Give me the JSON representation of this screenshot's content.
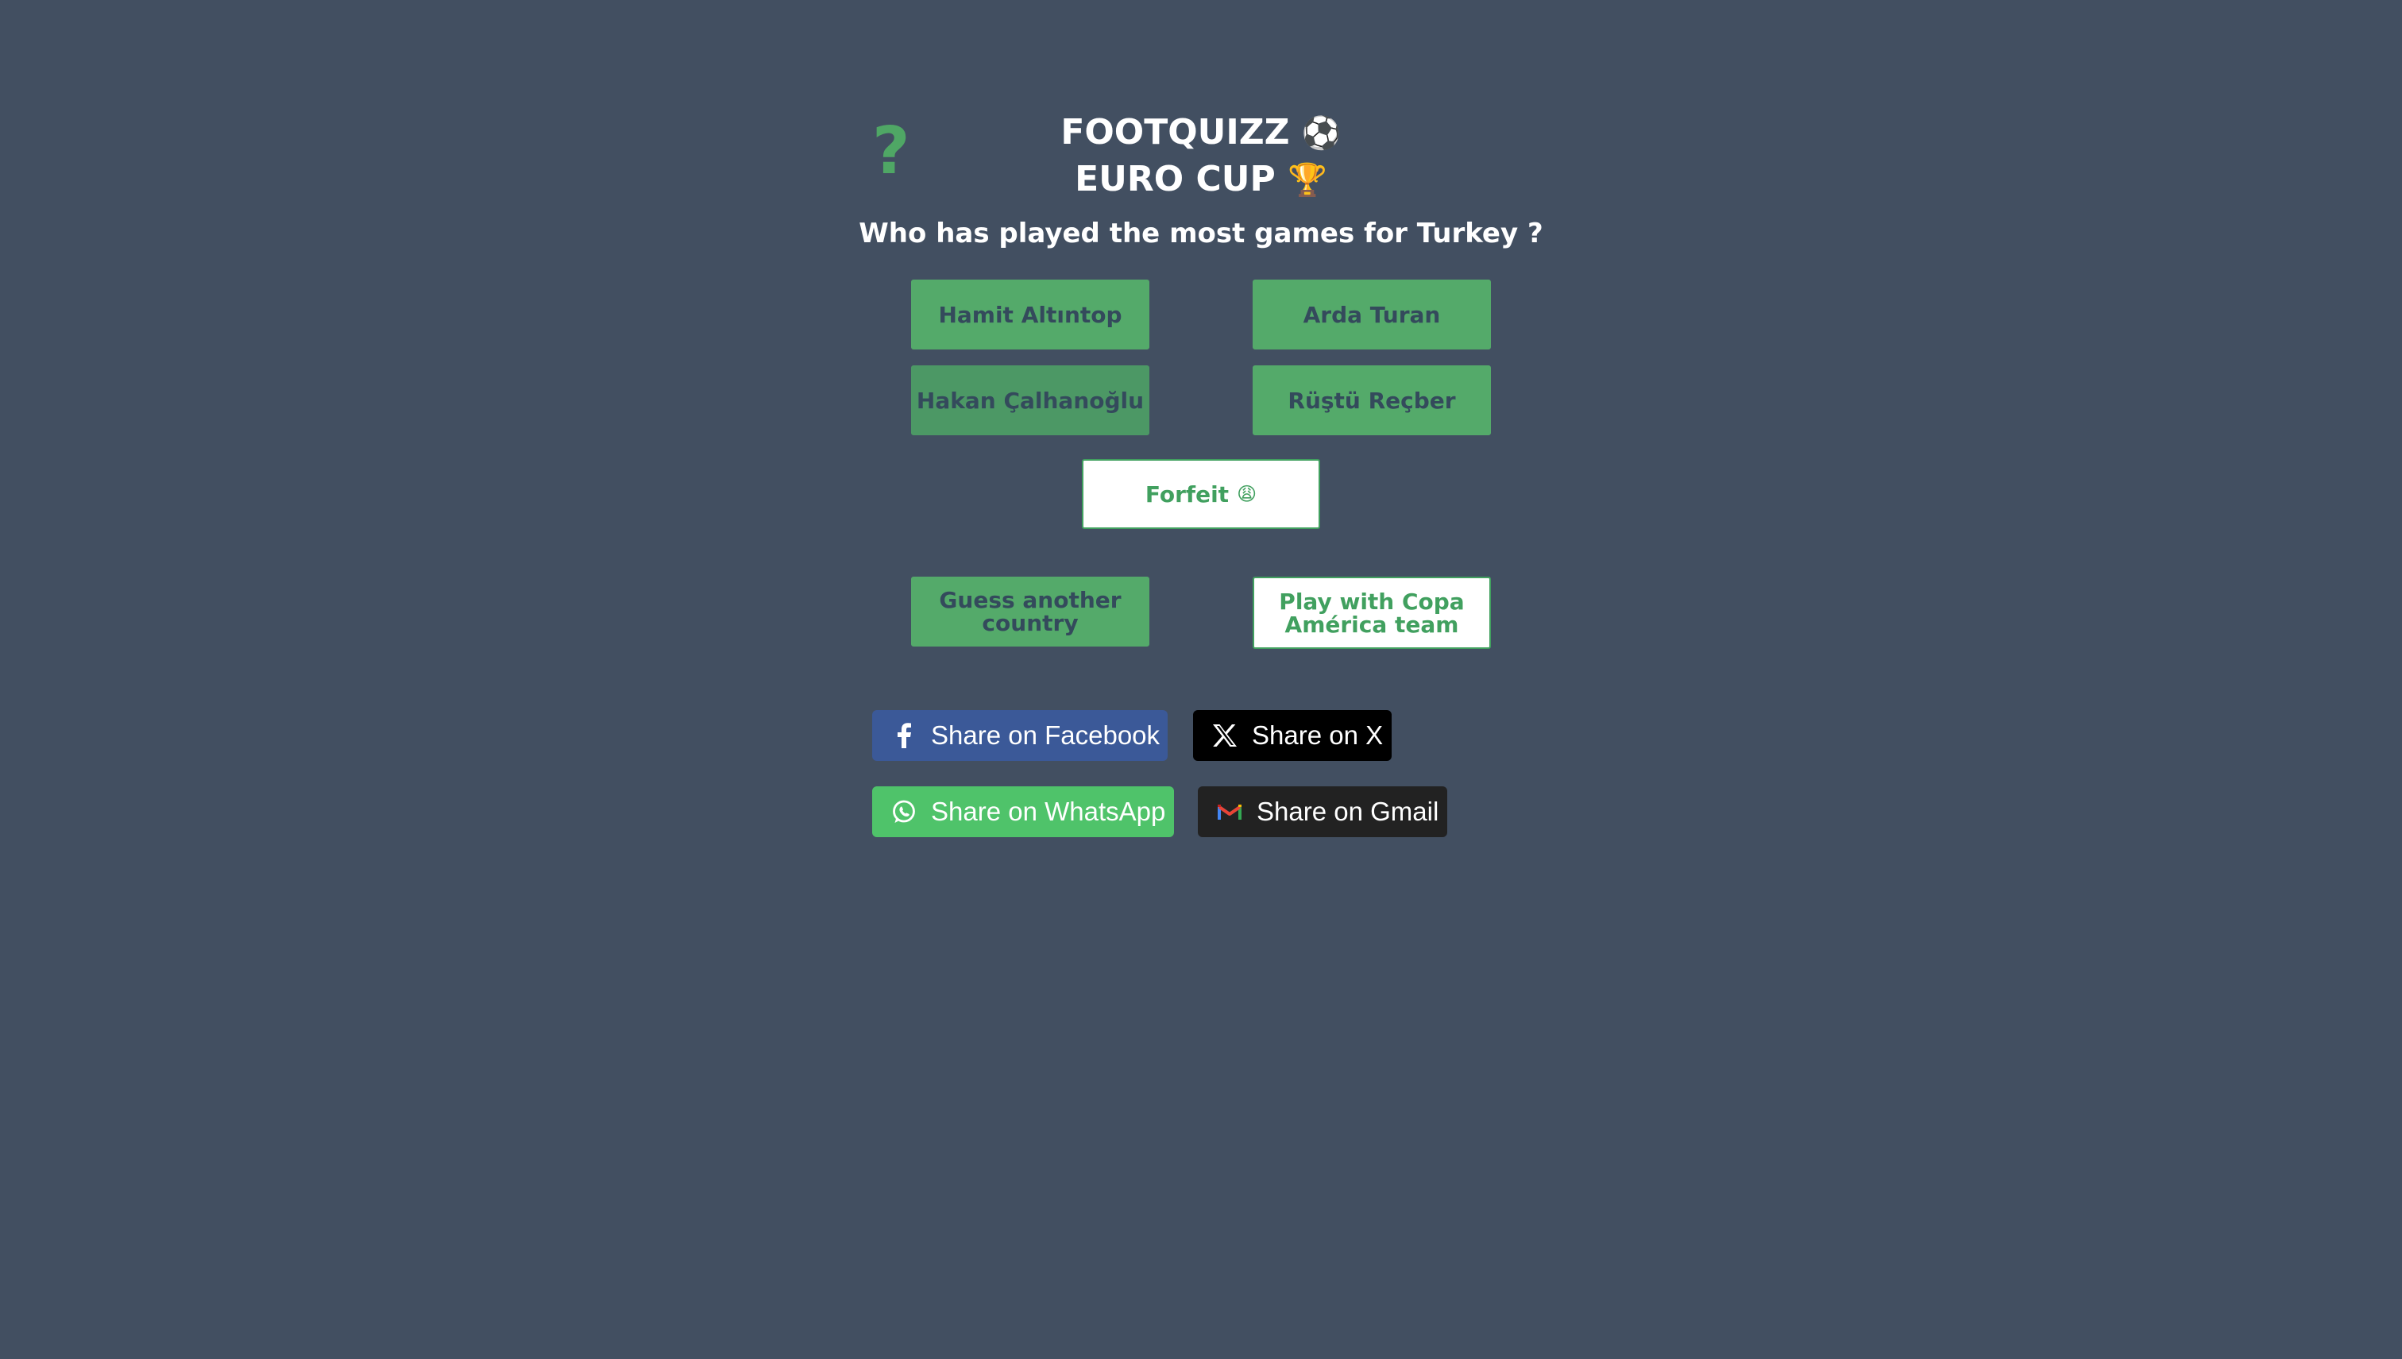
{
  "header": {
    "help_symbol": "?",
    "title_line1": "FOOTQUIZZ",
    "title_line1_emoji": "⚽",
    "title_line2": "EURO CUP",
    "title_line2_emoji": "🏆"
  },
  "question": "Who has played the most games for Turkey ?",
  "answers": [
    {
      "label": "Hamit Altıntop"
    },
    {
      "label": "Arda Turan"
    },
    {
      "label": "Hakan Çalhanoğlu"
    },
    {
      "label": "Rüştü Reçber"
    }
  ],
  "forfeit": {
    "label": "Forfeit",
    "emoji": "😩"
  },
  "actions": {
    "guess_another": "Guess another country",
    "copa_america": "Play with Copa América team"
  },
  "share": {
    "facebook": "Share on Facebook",
    "x": "Share on X",
    "whatsapp": "Share on WhatsApp",
    "gmail": "Share on Gmail"
  },
  "colors": {
    "background": "#424f61",
    "accent_green": "#54aa6a",
    "facebook": "#3b5998",
    "x": "#000000",
    "whatsapp": "#4fc36a",
    "gmail": "#222222"
  },
  "icons": {
    "help": "question-mark-icon",
    "facebook": "facebook-icon",
    "x": "x-logo-icon",
    "whatsapp": "whatsapp-icon",
    "gmail": "gmail-icon"
  }
}
